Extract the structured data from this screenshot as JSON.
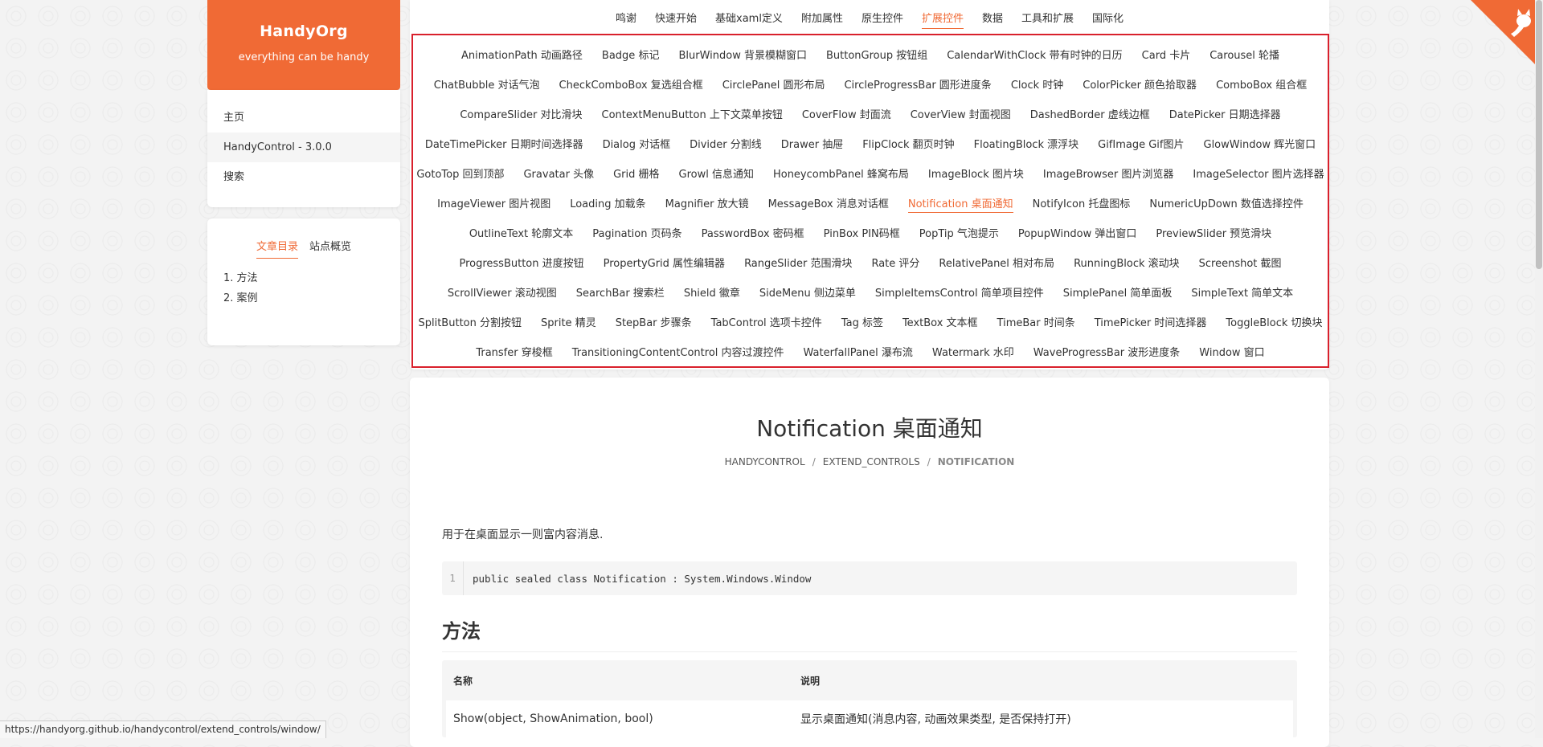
{
  "brand": {
    "title": "HandyOrg",
    "subtitle": "everything can be handy"
  },
  "side_menu": {
    "items": [
      {
        "label": "主页"
      },
      {
        "label": "HandyControl - 3.0.0"
      },
      {
        "label": "搜索"
      }
    ]
  },
  "toc": {
    "tabs": [
      "文章目录",
      "站点概览"
    ],
    "items": [
      "1. 方法",
      "2. 案例"
    ]
  },
  "top_nav": {
    "items": [
      "鸣谢",
      "快速开始",
      "基础xaml定义",
      "附加属性",
      "原生控件",
      "扩展控件",
      "数据",
      "工具和扩展",
      "国际化"
    ]
  },
  "controls": {
    "rows": [
      [
        "AnimationPath 动画路径",
        "Badge 标记",
        "BlurWindow 背景模糊窗口",
        "ButtonGroup 按钮组",
        "CalendarWithClock 带有时钟的日历",
        "Card 卡片",
        "Carousel 轮播"
      ],
      [
        "ChatBubble 对话气泡",
        "CheckComboBox 复选组合框",
        "CirclePanel 圆形布局",
        "CircleProgressBar 圆形进度条",
        "Clock 时钟",
        "ColorPicker 颜色拾取器",
        "ComboBox 组合框"
      ],
      [
        "CompareSlider 对比滑块",
        "ContextMenuButton 上下文菜单按钮",
        "CoverFlow 封面流",
        "CoverView 封面视图",
        "DashedBorder 虚线边框",
        "DatePicker 日期选择器"
      ],
      [
        "DateTimePicker 日期时间选择器",
        "Dialog 对话框",
        "Divider 分割线",
        "Drawer 抽屉",
        "FlipClock 翻页时钟",
        "FloatingBlock 漂浮块",
        "GifImage Gif图片",
        "GlowWindow 辉光窗口"
      ],
      [
        "GotoTop 回到顶部",
        "Gravatar 头像",
        "Grid 栅格",
        "Growl 信息通知",
        "HoneycombPanel 蜂窝布局",
        "ImageBlock 图片块",
        "ImageBrowser 图片浏览器",
        "ImageSelector 图片选择器"
      ],
      [
        "ImageViewer 图片视图",
        "Loading 加载条",
        "Magnifier 放大镜",
        "MessageBox 消息对话框",
        "Notification 桌面通知",
        "NotifyIcon 托盘图标",
        "NumericUpDown 数值选择控件"
      ],
      [
        "OutlineText 轮廓文本",
        "Pagination 页码条",
        "PasswordBox 密码框",
        "PinBox PIN码框",
        "PopTip 气泡提示",
        "PopupWindow 弹出窗口",
        "PreviewSlider 预览滑块"
      ],
      [
        "ProgressButton 进度按钮",
        "PropertyGrid 属性编辑器",
        "RangeSlider 范围滑块",
        "Rate 评分",
        "RelativePanel 相对布局",
        "RunningBlock 滚动块",
        "Screenshot 截图"
      ],
      [
        "ScrollViewer 滚动视图",
        "SearchBar 搜索栏",
        "Shield 徽章",
        "SideMenu 侧边菜单",
        "SimpleItemsControl 简单项目控件",
        "SimplePanel 简单面板",
        "SimpleText 简单文本"
      ],
      [
        "SplitButton 分割按钮",
        "Sprite 精灵",
        "StepBar 步骤条",
        "TabControl 选项卡控件",
        "Tag 标签",
        "TextBox 文本框",
        "TimeBar 时间条",
        "TimePicker 时间选择器",
        "ToggleBlock 切换块"
      ],
      [
        "Transfer 穿梭框",
        "TransitioningContentControl 内容过渡控件",
        "WaterfallPanel 瀑布流",
        "Watermark 水印",
        "WaveProgressBar 波形进度条",
        "Window 窗口"
      ]
    ]
  },
  "page": {
    "title": "Notification 桌面通知",
    "breadcrumb": [
      "HANDYCONTROL",
      "EXTEND_CONTROLS",
      "NOTIFICATION"
    ],
    "description": "用于在桌面显示一则富内容消息.",
    "code": {
      "line": "1",
      "text": "public sealed class Notification : System.Windows.Window"
    },
    "section_title": "方法",
    "table": {
      "headers": [
        "名称",
        "说明"
      ],
      "rows": [
        [
          "Show(object, ShowAnimation, bool)",
          "显示桌面通知(消息内容, 动画效果类型, 是否保持打开)"
        ]
      ]
    }
  },
  "status_url": "https://handyorg.github.io/handycontrol/extend_controls/window/",
  "colors": {
    "accent": "#f06a35",
    "highlight_border": "#d9202c"
  }
}
